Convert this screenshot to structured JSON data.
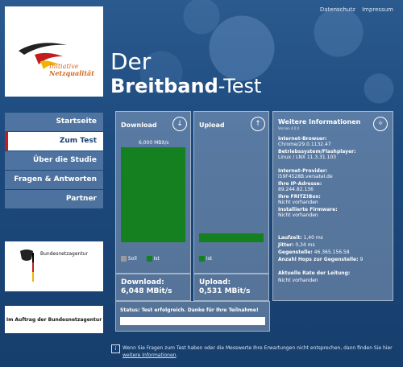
{
  "top_links": {
    "datenschutz": "Datenschutz",
    "impressum": "Impressum"
  },
  "logo": {
    "line1": "Initiative",
    "line2": "Netzqualität"
  },
  "title": {
    "line1": "Der",
    "line2_bold": "Breitband",
    "line2_rest": "-Test"
  },
  "nav": {
    "items": [
      "Startseite",
      "Zum Test",
      "Über die Studie",
      "Fragen & Antworten",
      "Partner"
    ],
    "active_index": 1
  },
  "bundes": {
    "name": "Bundesnetzagentur"
  },
  "auftrag": {
    "text": "Im Auftrag der Bundesnetzagentur"
  },
  "download": {
    "heading": "Download",
    "bar_value_label": "6,000 MBit/s",
    "legend_soll": "Soll",
    "legend_ist": "Ist",
    "result_label": "Download:",
    "result_value": "6,048 MBit/s",
    "fill_fraction": 1.0
  },
  "upload": {
    "heading": "Upload",
    "legend_ist": "Ist",
    "result_label": "Upload:",
    "result_value": "0,531 MBit/s",
    "fill_fraction": 0.09
  },
  "info": {
    "heading": "Weitere Informationen",
    "version": "Version 4.0.0",
    "browser_label": "Internet-Browser:",
    "browser_value": "Chrome/29.0.1132.47",
    "os_label": "Betriebssystem/Flashplayer:",
    "os_value": "Linux / LNX 11.3.31.103",
    "provider_label": "Internet-Provider:",
    "provider_value": "i59F4528B.versatel.de",
    "ip_label": "Ihre IP-Adresse:",
    "ip_value": "89.244.82.136",
    "fritz_label": "Ihre FRITZ!Box:",
    "fritz_value": "Nicht vorhanden",
    "firmware_label": "Installierte Firmware:",
    "firmware_value": "Nicht vorhanden",
    "laufzeit_label": "Laufzeit:",
    "laufzeit_value": "1,40 ms",
    "jitter_label": "Jitter:",
    "jitter_value": "0,34 ms",
    "gegenstelle_label": "Gegenstelle:",
    "gegenstelle_value": "46.365.156.58",
    "hops_label": "Anzahl Hops zur Gegenstelle:",
    "hops_value": "9",
    "rate_label": "Aktuelle Rate der Leitung:",
    "rate_value": "Nicht vorhanden"
  },
  "status": {
    "text": "Status: Test erfolgreich. Danke für Ihre Teilnahme!"
  },
  "footer": {
    "text": "Wenn Sie Fragen zum Test haben oder die Messwerte Ihre Erwartungen nicht entsprechen, dann finden Sie hier",
    "link": "weitere Informationen"
  },
  "colors": {
    "bar_green": "#15801f",
    "soll_gray": "#9a9a9a",
    "accent_red": "#c21d1d"
  }
}
